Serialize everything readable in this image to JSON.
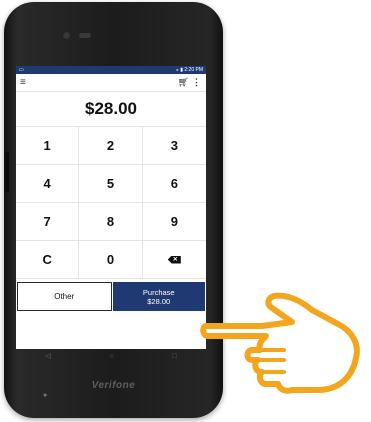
{
  "device": {
    "brand": "Verifone"
  },
  "status_bar": {
    "left_icon": "notification-icon",
    "time": "2:20 PM"
  },
  "app_bar": {
    "menu_icon": "hamburger-icon",
    "cart_icon": "cart-icon",
    "more_icon": "more-vert-icon"
  },
  "amount": "$28.00",
  "keypad": {
    "keys": [
      "1",
      "2",
      "3",
      "4",
      "5",
      "6",
      "7",
      "8",
      "9",
      "C",
      "0"
    ],
    "backspace_icon": "backspace-icon"
  },
  "actions": {
    "other_label": "Other",
    "purchase_label": "Purchase",
    "purchase_amount": "$28.00"
  },
  "nav_bar": {
    "back_icon": "nav-back-icon",
    "home_icon": "nav-home-icon",
    "recents_icon": "nav-recents-icon"
  },
  "colors": {
    "accent": "#1f3a72",
    "hand": "#f4a51e"
  }
}
